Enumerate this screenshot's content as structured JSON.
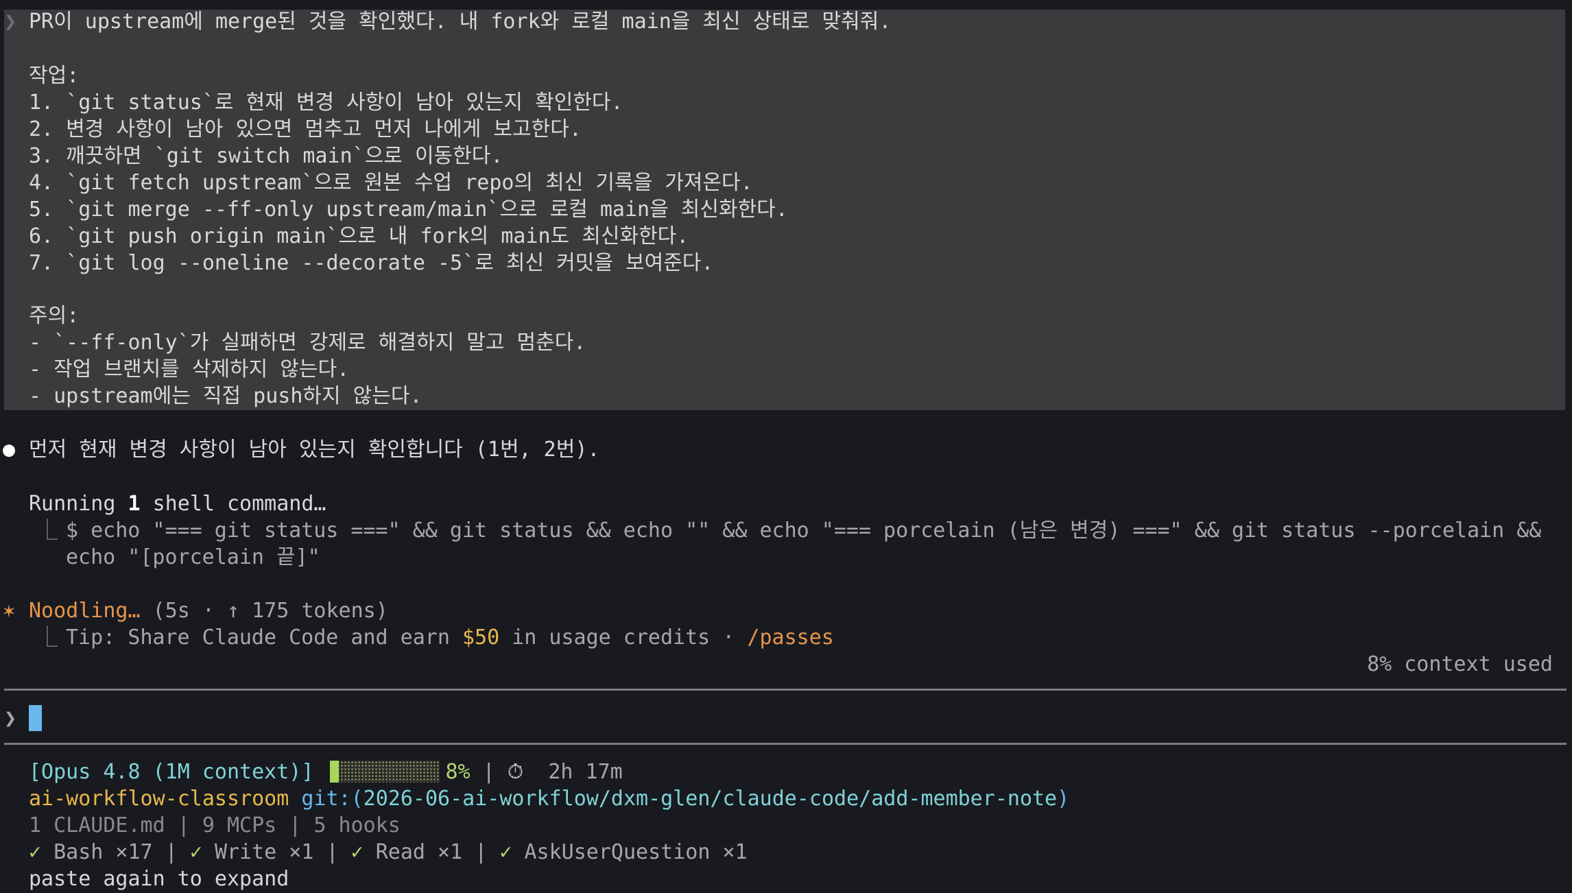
{
  "prompt": {
    "chevron": "❯",
    "lines": [
      "PR이 upstream에 merge된 것을 확인했다. 내 fork와 로컬 main을 최신 상태로 맞춰줘.",
      "",
      "작업:",
      "1. `git status`로 현재 변경 사항이 남아 있는지 확인한다.",
      "2. 변경 사항이 남아 있으면 멈추고 먼저 나에게 보고한다.",
      "3. 깨끗하면 `git switch main`으로 이동한다.",
      "4. `git fetch upstream`으로 원본 수업 repo의 최신 기록을 가져온다.",
      "5. `git merge --ff-only upstream/main`으로 로컬 main을 최신화한다.",
      "6. `git push origin main`으로 내 fork의 main도 최신화한다.",
      "7. `git log --oneline --decorate -5`로 최신 커밋을 보여준다.",
      "",
      "주의:",
      "- `--ff-only`가 실패하면 강제로 해결하지 말고 멈춘다.",
      "- 작업 브랜치를 삭제하지 않는다.",
      "- upstream에는 직접 push하지 않는다."
    ]
  },
  "assistant": {
    "bullet": "●",
    "message": "먼저 현재 변경 사항이 남아 있는지 확인합니다 (1번, 2번).",
    "running_prefix": "Running ",
    "running_count": "1",
    "running_suffix": " shell command…",
    "tree_glyph": "⎿",
    "command_line1": "$ echo \"=== git status ===\" && git status && echo \"\" && echo \"=== porcelain (남은 변경) ===\" && git status --porcelain &&",
    "command_line2": "echo \"[porcelain 끝]\""
  },
  "status": {
    "spinner": "✶",
    "label": "Noodling…",
    "meta": "(5s · ↑ 175 tokens)",
    "tip_prefix": "Tip: Share Claude Code and earn ",
    "tip_amount": "$50",
    "tip_middle": " in usage credits · ",
    "tip_command": "/passes",
    "context_used": "8% context used"
  },
  "input": {
    "chevron": "❯",
    "value": ""
  },
  "statusline": {
    "model": "[Opus 4.8 (1M context)]",
    "context_percent_value": 8,
    "context_percent": "8%",
    "separator": "|",
    "timer_icon": "⏱",
    "elapsed": "2h 17m",
    "repo": "ai-workflow-classroom",
    "git_label": "git:(",
    "branch": "2026-06-ai-workflow/dxm-glen/claude-code/add-member-note",
    "git_close": ")",
    "config": "1 CLAUDE.md | 9 MCPs | 5 hooks",
    "tools": [
      {
        "check": "✓",
        "label": "Bash ×17"
      },
      {
        "check": "✓",
        "label": "Write ×1"
      },
      {
        "check": "✓",
        "label": "Read ×1"
      },
      {
        "check": "✓",
        "label": "AskUserQuestion ×1"
      }
    ],
    "paste_hint": "paste again to expand"
  },
  "colors": {
    "background": "#181a20",
    "prompt_block": "#3a3b3d",
    "accent_orange": "#e8954a",
    "accent_green": "#b5d66e",
    "accent_cyan": "#7fd3d6",
    "cursor": "#6ab7ee"
  }
}
